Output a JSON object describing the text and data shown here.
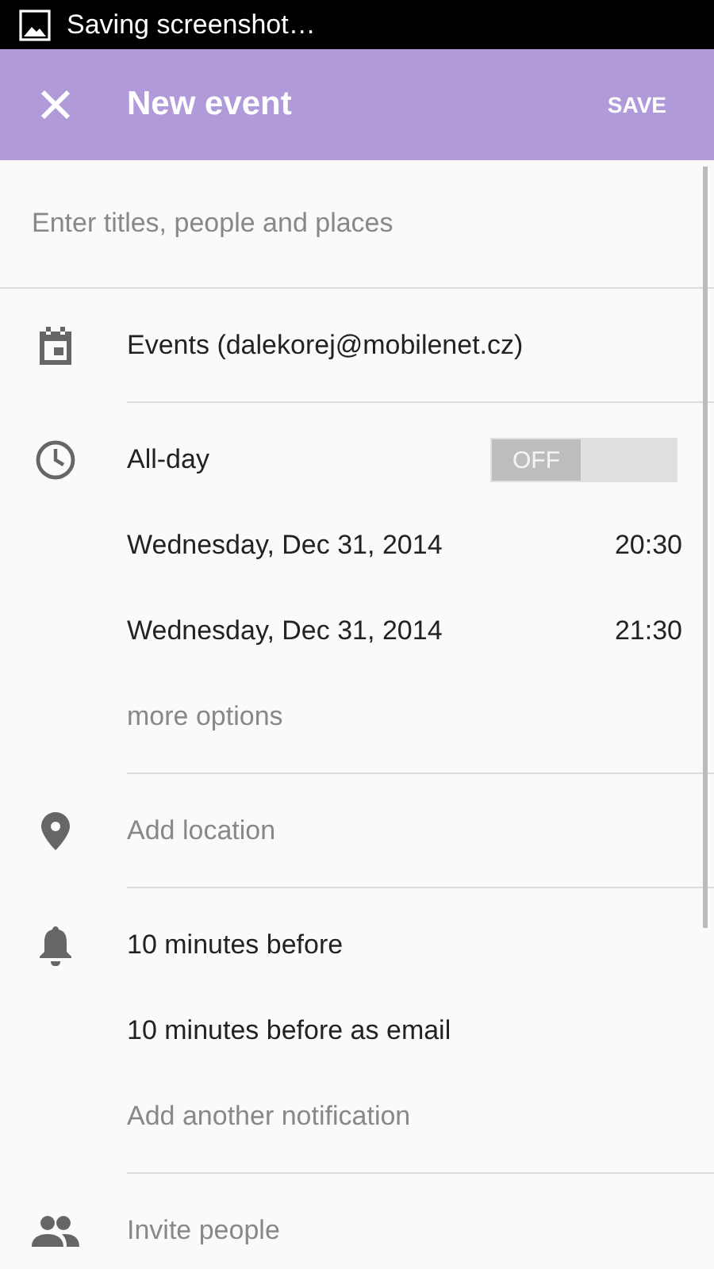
{
  "status_bar": {
    "text": "Saving screenshot…"
  },
  "toolbar": {
    "title": "New event",
    "action": "SAVE"
  },
  "title_field": {
    "placeholder": "Enter titles, people and places"
  },
  "sections": [
    {
      "kind": "calendar",
      "rows": [
        {
          "kind": "primary",
          "text": "Events (dalekorej@mobilenet.cz)"
        }
      ]
    },
    {
      "kind": "time",
      "rows": [
        {
          "kind": "toggle",
          "label": "All-day",
          "state_label": "OFF",
          "on": false
        },
        {
          "kind": "datetime",
          "date": "Wednesday, Dec 31, 2014",
          "time": "20:30"
        },
        {
          "kind": "datetime",
          "date": "Wednesday, Dec 31, 2014",
          "time": "21:30"
        },
        {
          "kind": "hint",
          "text": "more options"
        }
      ]
    },
    {
      "kind": "location",
      "rows": [
        {
          "kind": "hint",
          "text": "Add location"
        }
      ]
    },
    {
      "kind": "notifications",
      "rows": [
        {
          "kind": "primary",
          "text": "10 minutes before"
        },
        {
          "kind": "primary",
          "text": "10 minutes before as email"
        },
        {
          "kind": "hint",
          "text": "Add another notification"
        }
      ]
    },
    {
      "kind": "guests",
      "rows": [
        {
          "kind": "hint",
          "text": "Invite people"
        }
      ]
    }
  ]
}
